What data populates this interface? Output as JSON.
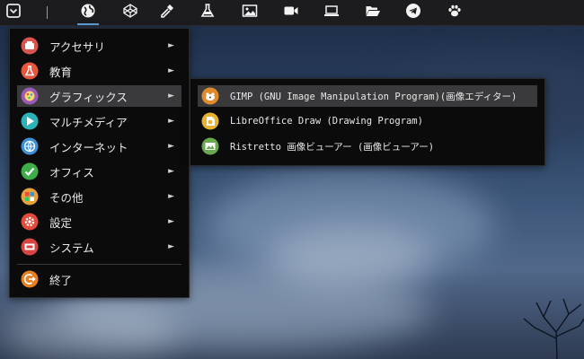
{
  "panel": {
    "buttons": [
      {
        "icon": "menu-square-icon"
      },
      {
        "icon": "globe-icon"
      },
      {
        "icon": "codepen-icon"
      },
      {
        "icon": "eyedropper-icon"
      },
      {
        "icon": "flask-icon"
      },
      {
        "icon": "image-icon"
      },
      {
        "icon": "video-camera-icon"
      },
      {
        "icon": "laptop-icon"
      },
      {
        "icon": "folder-open-icon"
      },
      {
        "icon": "telegram-icon"
      },
      {
        "icon": "paw-icon"
      }
    ],
    "accent_color": "#5c9fd6"
  },
  "main_menu": {
    "items": [
      {
        "label": "アクセサリ",
        "icon": "accessories-icon",
        "color": "#d9534f",
        "has_submenu": true
      },
      {
        "label": "教育",
        "icon": "education-icon",
        "color": "#e8563e",
        "has_submenu": true
      },
      {
        "label": "グラフィックス",
        "icon": "graphics-icon",
        "color": "#9b59b6",
        "has_submenu": true,
        "highlighted": true
      },
      {
        "label": "マルチメディア",
        "icon": "multimedia-icon",
        "color": "#2ab3b8",
        "has_submenu": true
      },
      {
        "label": "インターネット",
        "icon": "internet-icon",
        "color": "#3d8fd6",
        "has_submenu": true
      },
      {
        "label": "オフィス",
        "icon": "office-icon",
        "color": "#3fae49",
        "has_submenu": true
      },
      {
        "label": "その他",
        "icon": "other-icon",
        "color": "#e9a23b",
        "has_submenu": true
      },
      {
        "label": "設定",
        "icon": "settings-icon",
        "color": "#e14b3b",
        "has_submenu": true
      },
      {
        "label": "システム",
        "icon": "system-icon",
        "color": "#d64541",
        "has_submenu": true
      }
    ],
    "exit": {
      "label": "終了",
      "icon": "exit-icon",
      "color": "#e67e22"
    },
    "arrow_glyph": "►"
  },
  "sub_menu": {
    "items": [
      {
        "label": "GIMP (GNU Image Manipulation Program)(画像エディター)",
        "icon": "gimp-icon",
        "color": "#e08a2c",
        "highlighted": true
      },
      {
        "label": "LibreOffice Draw (Drawing Program)",
        "icon": "libreoffice-draw-icon",
        "color": "#e8b32b"
      },
      {
        "label": "Ristretto 画像ビューアー (画像ビューアー)",
        "icon": "ristretto-icon",
        "color": "#6aa84f"
      }
    ]
  }
}
